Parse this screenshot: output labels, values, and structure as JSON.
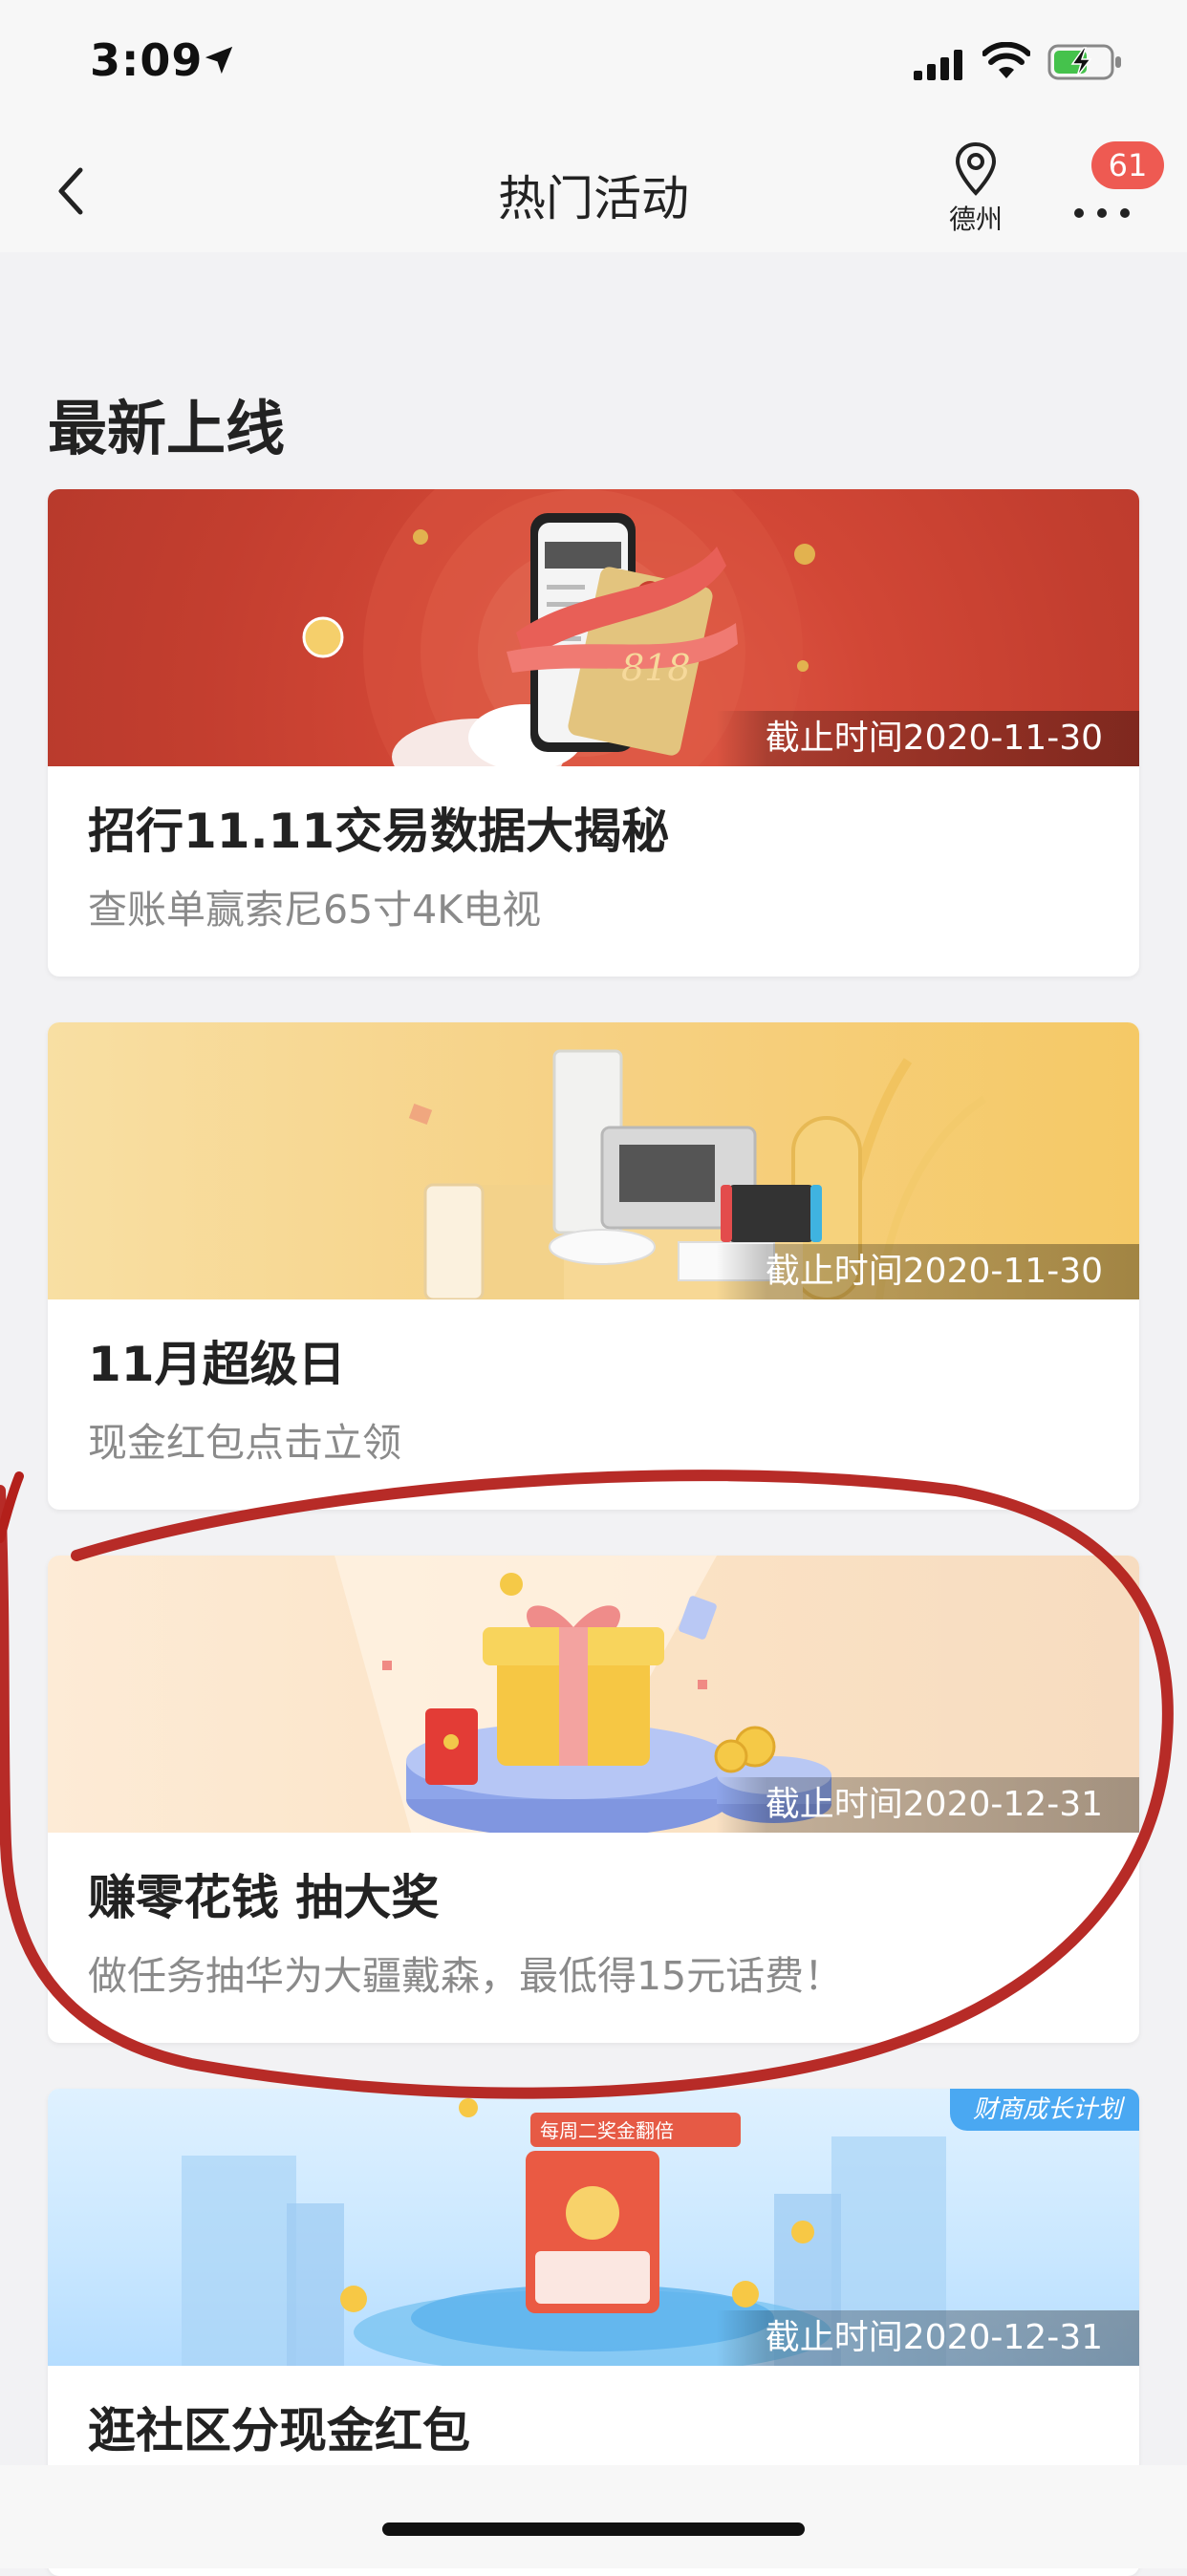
{
  "status_bar": {
    "time": "3:09"
  },
  "nav": {
    "title": "热门活动",
    "city": "德州",
    "badge": "61"
  },
  "section": {
    "title": "最新上线"
  },
  "cards": [
    {
      "title": "招行11.11交易数据大揭秘",
      "subtitle": "查账单赢索尼65寸4K电视",
      "deadline": "截止时间2020-11-30",
      "banner_text": "818"
    },
    {
      "title": "11月超级日",
      "subtitle": "现金红包点击立领",
      "deadline": "截止时间2020-11-30"
    },
    {
      "title": "赚零花钱 抽大奖",
      "subtitle": "做任务抽华为大疆戴森，最低得15元话费！",
      "deadline": "截止时间2020-12-31"
    },
    {
      "title": "逛社区分现金红包",
      "subtitle": "",
      "deadline": "截止时间2020-12-31",
      "tag": "财商成长计划",
      "banner_text": "每周二奖金翻倍"
    }
  ],
  "colors": {
    "accent_red": "#ee5a52",
    "annotation": "#b3201b"
  }
}
